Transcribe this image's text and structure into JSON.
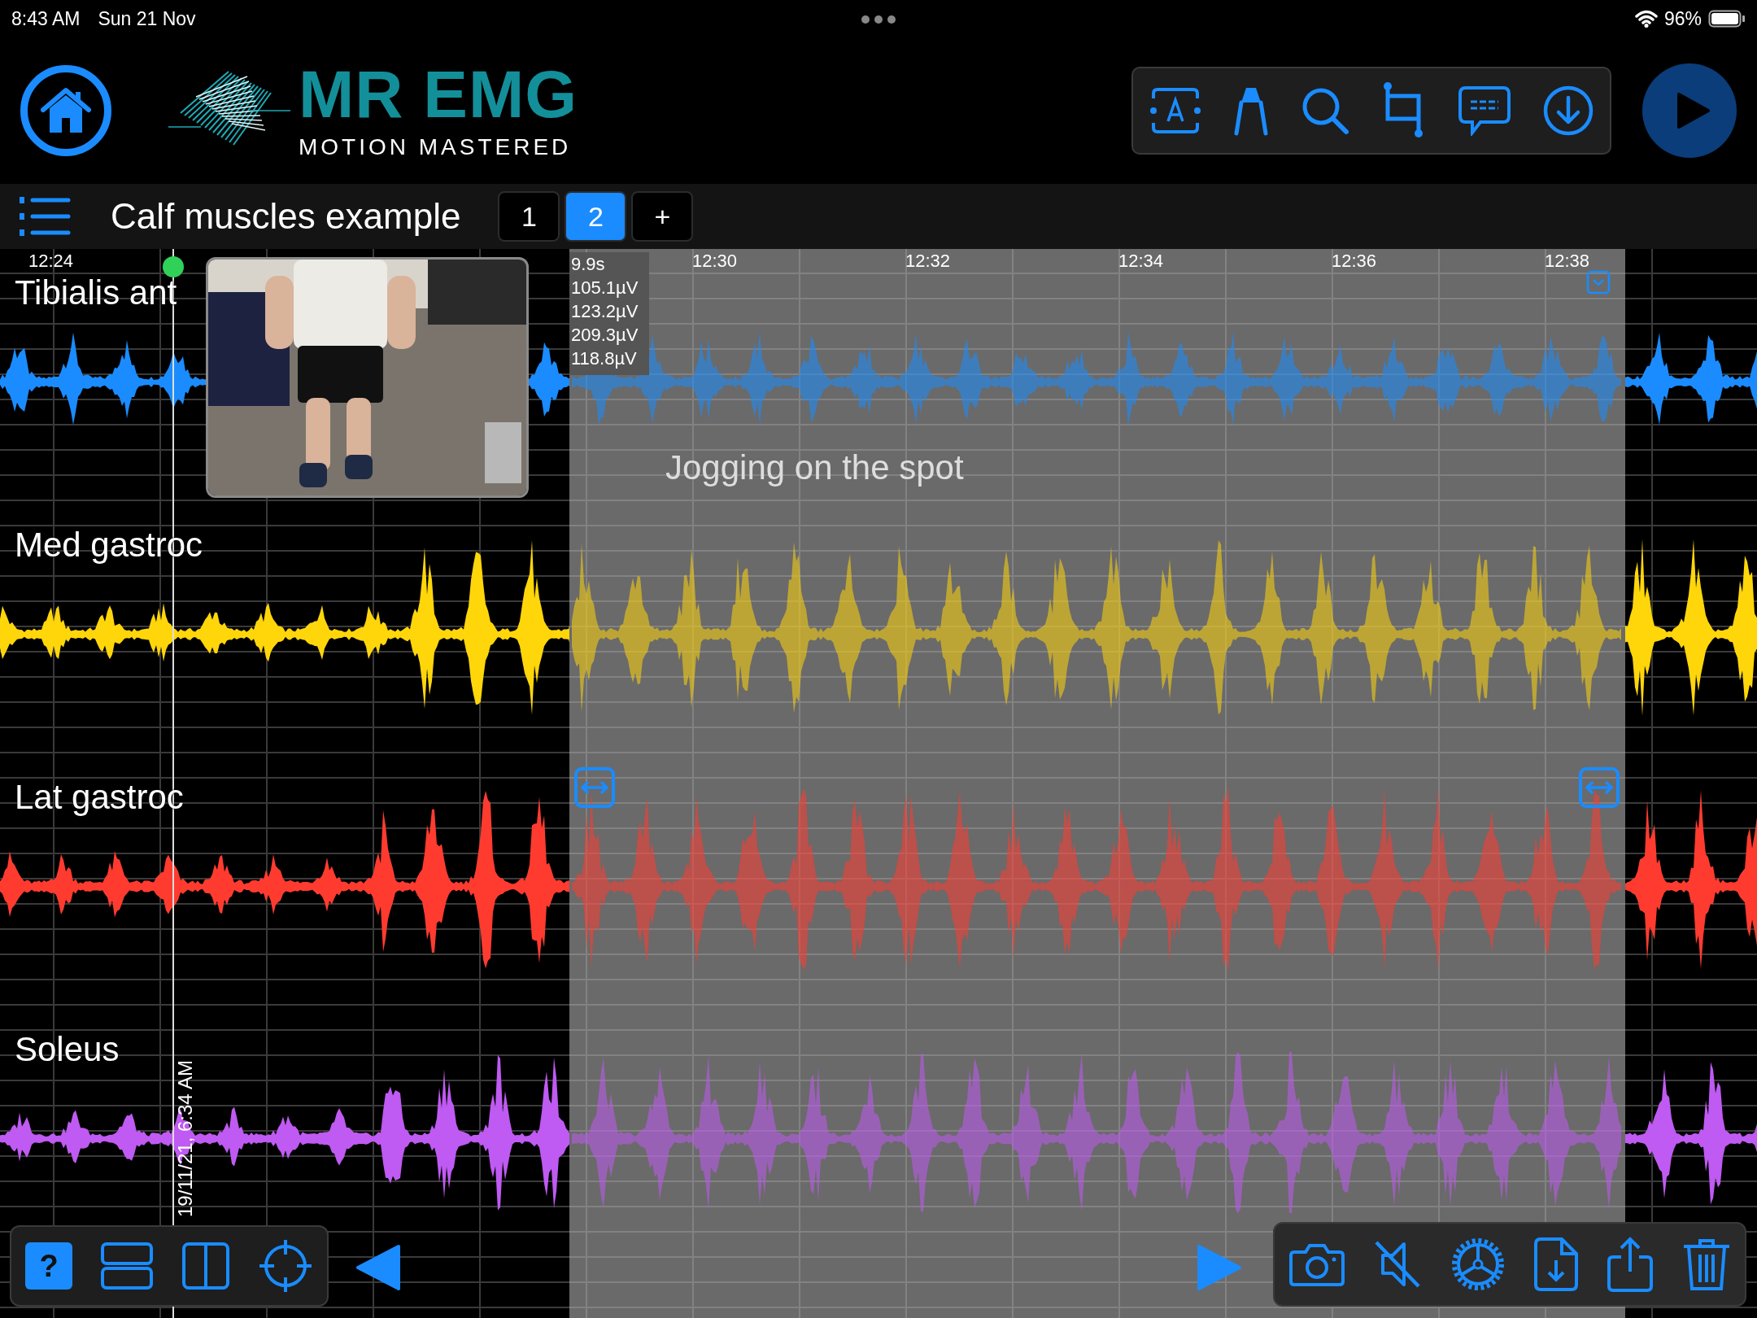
{
  "status_bar": {
    "time": "8:43 AM",
    "date": "Sun 21 Nov",
    "battery": "96%"
  },
  "header": {
    "logo_title": "MR EMG",
    "logo_subtitle": "MOTION MASTERED"
  },
  "title_bar": {
    "title": "Calf muscles example",
    "add_label": "+",
    "pages": [
      {
        "label": "1",
        "selected": false
      },
      {
        "label": "2",
        "selected": true
      }
    ]
  },
  "timeline": {
    "time_labels": [
      "12:24",
      "12:30",
      "12:32",
      "12:34",
      "12:36",
      "12:38"
    ],
    "cursor_date": "19/11/21, 6:34 AM",
    "readout": [
      "9.9s",
      "105.1µV",
      "123.2µV",
      "209.3µV",
      "118.8µV"
    ],
    "annotation": "Jogging on the spot"
  },
  "channels": [
    {
      "name": "Tibialis ant",
      "color": "#1a8cff"
    },
    {
      "name": "Med gastroc",
      "color": "#ffd60a"
    },
    {
      "name": "Lat gastroc",
      "color": "#ff3b30"
    },
    {
      "name": "Soleus",
      "color": "#bf5af2"
    }
  ],
  "bottom_bar": {
    "help_label": "?"
  }
}
